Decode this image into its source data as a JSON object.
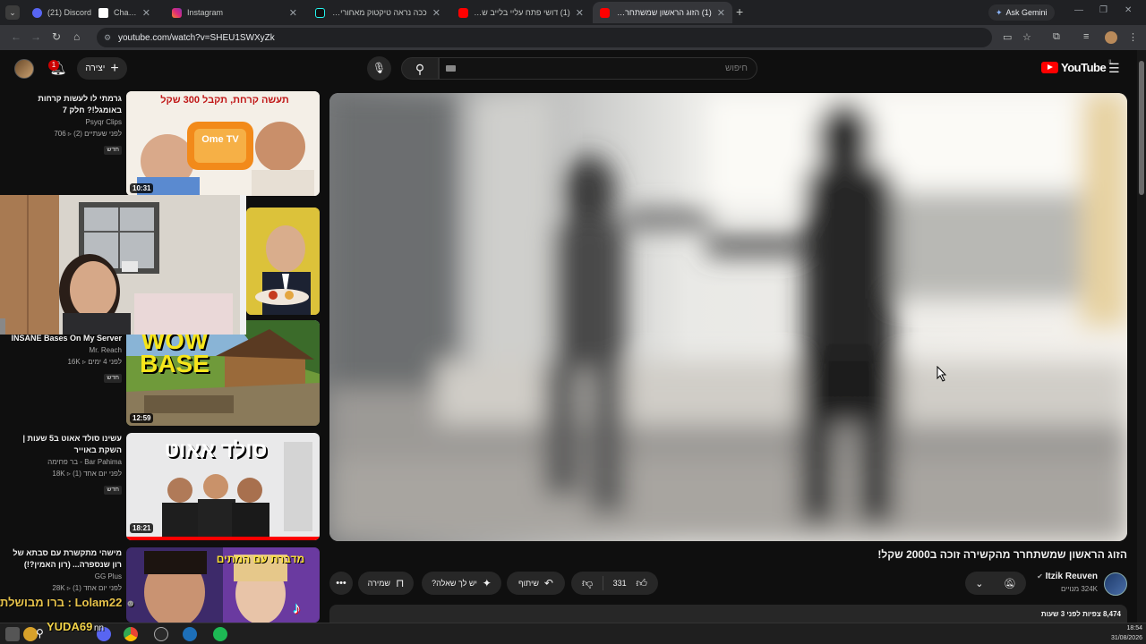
{
  "browser": {
    "tabs": [
      {
        "title": "(21) Discord | #",
        "color": "#5865f2"
      },
      {
        "title": "Chat | R",
        "color": "#ffffff"
      },
      {
        "title": "Instagram",
        "color": "#e1306c"
      },
      {
        "title": "ככה נראה טיקטוק מאחורי הקל",
        "color": "#111111"
      },
      {
        "title": "(1) דושי פתח עליי בלייב שלו.. ה",
        "color": "#ff0000"
      },
      {
        "title": "(1) הזוג הראשון שמשתחרר מה",
        "color": "#ff0000"
      }
    ],
    "ask_gemini": "Ask Gemini",
    "url": "youtube.com/watch?v=SHEU1SWXyZk"
  },
  "header": {
    "search_placeholder": "חיפוש",
    "create_label": "יצירה",
    "notif_count": "1",
    "logo_text": "YouTube",
    "logo_country": "IL"
  },
  "recommendations": [
    {
      "title": "גרמתי לו לעשות קרחות באומגל!? חלק 7",
      "channel": "Psyqr Clips",
      "views": "706",
      "age": "לפני שעתיים (2)",
      "badge": "חדש",
      "duration": "10:31",
      "thumb_text": "תעשה קרחת, תקבל 300 שקל",
      "thumb_logo": "Ome TV"
    },
    {
      "title": "",
      "channel": "",
      "views": "",
      "age": "",
      "badge": "",
      "duration": "",
      "thumb_text": "",
      "thumb_logo": ""
    },
    {
      "title": "INSANE Bases On My Server",
      "channel": "Mr. Reach",
      "views": "16K",
      "age": "לפני 4 ימים",
      "badge": "חדש",
      "duration": "12:59",
      "thumb_text": "WOW BASE",
      "thumb_logo": ""
    },
    {
      "title": "עשינו סולד אאוט ב5 שעות | השקת באוייר",
      "channel": "Bar Pahima - בר פחימה",
      "views": "18K",
      "age": "לפני יום אחד (1)",
      "badge": "חדש",
      "duration": "18:21",
      "thumb_text": "סולד אאוט",
      "thumb_logo": ""
    },
    {
      "title": "מישהי מתקשרת עם סבתא של רון שנספרה... (רון האמין?!)",
      "channel": "GG Plus",
      "views": "28K",
      "age": "לפני יום אחד (1)",
      "badge": "",
      "duration": "",
      "thumb_text": "מדברת עם המתים",
      "thumb_logo": ""
    }
  ],
  "video": {
    "title": "הזוג הראשון שמשתחרר מהקשירה זוכה ב2000 שקל!",
    "channel_name": "Itzik Reuven",
    "subscribers": "324K מנויים",
    "likes": "331",
    "share_label": "שיתוף",
    "ask_label": "יש לך שאלה?",
    "save_label": "שמירה",
    "views_line": "8,474 צפיות  לפני 3 שעות"
  },
  "overlay": {
    "chat_line": "Lolam22 : ברו מבושלת",
    "viewer_name": "YUDA69",
    "viewer_tail": "nn"
  },
  "taskbar": {
    "time": "18:54",
    "date": "31/08/2026"
  }
}
